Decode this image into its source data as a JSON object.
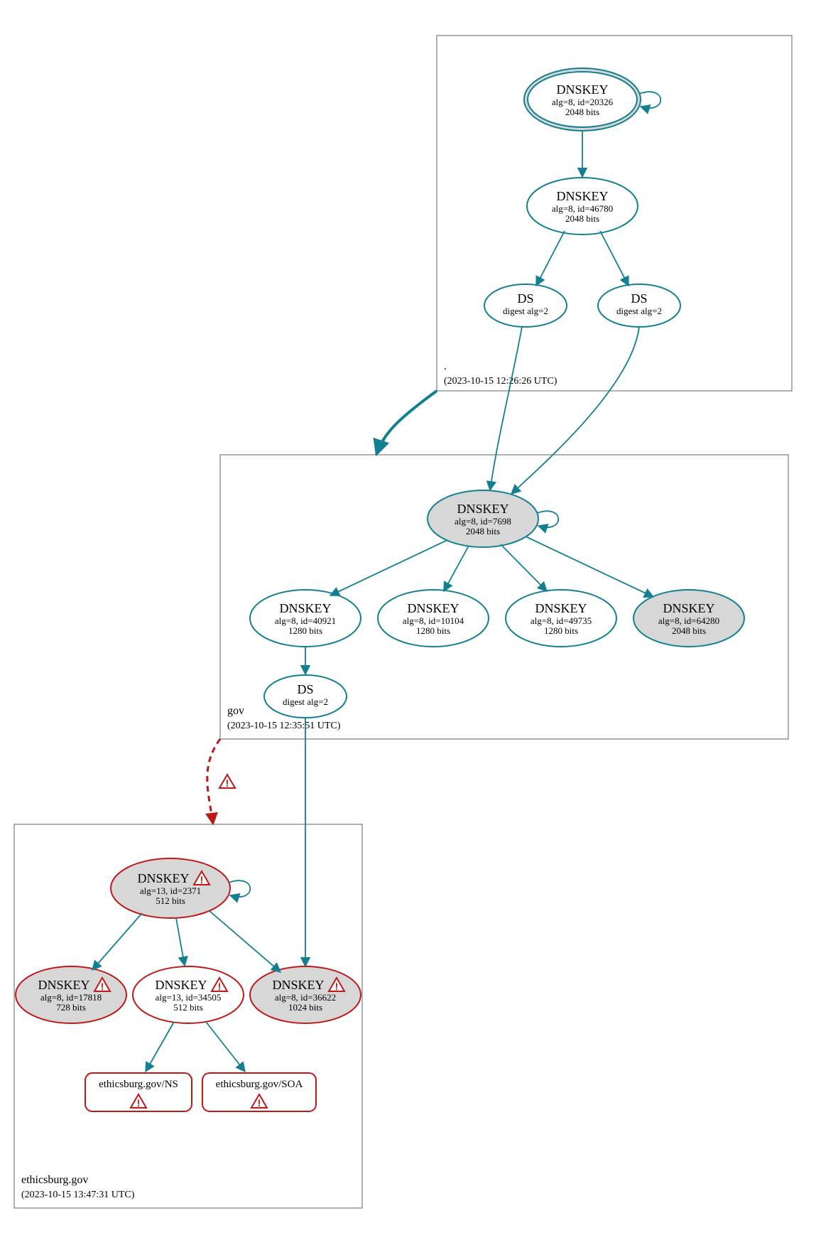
{
  "chart_data": {
    "type": "diagram",
    "description": "DNSSEC chain-of-trust graph for ethicsburg.gov",
    "zones": [
      {
        "name": ".",
        "timestamp": "(2023-10-15 12:26:26 UTC)",
        "nodes": [
          {
            "id": "root-ksk",
            "type": "DNSKEY",
            "alg": 8,
            "key_id": 20326,
            "bits": 2048,
            "sep": true,
            "trust_anchor": true,
            "warn": false
          },
          {
            "id": "root-zsk",
            "type": "DNSKEY",
            "alg": 8,
            "key_id": 46780,
            "bits": 2048,
            "sep": false,
            "warn": false
          },
          {
            "id": "root-ds1",
            "type": "DS",
            "digest_alg": 2,
            "warn": false
          },
          {
            "id": "root-ds2",
            "type": "DS",
            "digest_alg": 2,
            "warn": false
          }
        ],
        "edges": [
          {
            "from": "root-ksk",
            "to": "root-ksk",
            "self_loop": true
          },
          {
            "from": "root-ksk",
            "to": "root-zsk"
          },
          {
            "from": "root-zsk",
            "to": "root-ds1"
          },
          {
            "from": "root-zsk",
            "to": "root-ds2"
          }
        ]
      },
      {
        "name": "gov",
        "timestamp": "(2023-10-15 12:35:51 UTC)",
        "nodes": [
          {
            "id": "gov-ksk",
            "type": "DNSKEY",
            "alg": 8,
            "key_id": 7698,
            "bits": 2048,
            "sep": true,
            "warn": false
          },
          {
            "id": "gov-zsk1",
            "type": "DNSKEY",
            "alg": 8,
            "key_id": 40921,
            "bits": 1280,
            "sep": false,
            "warn": false
          },
          {
            "id": "gov-zsk2",
            "type": "DNSKEY",
            "alg": 8,
            "key_id": 10104,
            "bits": 1280,
            "sep": false,
            "warn": false
          },
          {
            "id": "gov-zsk3",
            "type": "DNSKEY",
            "alg": 8,
            "key_id": 49735,
            "bits": 1280,
            "sep": false,
            "warn": false
          },
          {
            "id": "gov-key64",
            "type": "DNSKEY",
            "alg": 8,
            "key_id": 64280,
            "bits": 2048,
            "sep": true,
            "warn": false
          },
          {
            "id": "gov-ds",
            "type": "DS",
            "digest_alg": 2,
            "warn": false
          }
        ],
        "edges": [
          {
            "from": "root-ds1",
            "to": "gov-ksk",
            "cross_zone": true
          },
          {
            "from": "root-ds2",
            "to": "gov-ksk",
            "cross_zone": true
          },
          {
            "from": "gov-ksk",
            "to": "gov-ksk",
            "self_loop": true
          },
          {
            "from": "gov-ksk",
            "to": "gov-zsk1"
          },
          {
            "from": "gov-ksk",
            "to": "gov-zsk2"
          },
          {
            "from": "gov-ksk",
            "to": "gov-zsk3"
          },
          {
            "from": "gov-ksk",
            "to": "gov-key64"
          },
          {
            "from": "gov-zsk1",
            "to": "gov-ds"
          }
        ]
      },
      {
        "name": "ethicsburg.gov",
        "timestamp": "(2023-10-15 13:47:31 UTC)",
        "nodes": [
          {
            "id": "eb-ksk",
            "type": "DNSKEY",
            "alg": 13,
            "key_id": 2371,
            "bits": 512,
            "sep": true,
            "warn": true
          },
          {
            "id": "eb-key1",
            "type": "DNSKEY",
            "alg": 8,
            "key_id": 17818,
            "bits": 728,
            "sep": true,
            "warn": true
          },
          {
            "id": "eb-zsk",
            "type": "DNSKEY",
            "alg": 13,
            "key_id": 34505,
            "bits": 512,
            "sep": false,
            "warn": true
          },
          {
            "id": "eb-key3",
            "type": "DNSKEY",
            "alg": 8,
            "key_id": 36622,
            "bits": 1024,
            "sep": true,
            "warn": true
          },
          {
            "id": "eb-ns",
            "type": "RRset",
            "label": "ethicsburg.gov/NS",
            "warn": true
          },
          {
            "id": "eb-soa",
            "type": "RRset",
            "label": "ethicsburg.gov/SOA",
            "warn": true
          }
        ],
        "edges": [
          {
            "from": "gov-ds",
            "to": "eb-key3",
            "cross_zone": true
          },
          {
            "from": "gov-zone",
            "to": "eb-zone",
            "cross_zone": true,
            "warn": true,
            "dashed": true
          },
          {
            "from": "eb-ksk",
            "to": "eb-ksk",
            "self_loop": true
          },
          {
            "from": "eb-ksk",
            "to": "eb-key1"
          },
          {
            "from": "eb-ksk",
            "to": "eb-zsk"
          },
          {
            "from": "eb-ksk",
            "to": "eb-key3"
          },
          {
            "from": "eb-zsk",
            "to": "eb-ns"
          },
          {
            "from": "eb-zsk",
            "to": "eb-soa"
          }
        ]
      }
    ]
  },
  "labels": {
    "dnskey": "DNSKEY",
    "ds": "DS",
    "root": {
      "name": ".",
      "ts": "(2023-10-15 12:26:26 UTC)",
      "ksk_sub1": "alg=8, id=20326",
      "ksk_sub2": "2048 bits",
      "zsk_sub1": "alg=8, id=46780",
      "zsk_sub2": "2048 bits",
      "ds_sub": "digest alg=2"
    },
    "gov": {
      "name": "gov",
      "ts": "(2023-10-15 12:35:51 UTC)",
      "ksk_sub1": "alg=8, id=7698",
      "ksk_sub2": "2048 bits",
      "k1_sub1": "alg=8, id=40921",
      "k1_sub2": "1280 bits",
      "k2_sub1": "alg=8, id=10104",
      "k2_sub2": "1280 bits",
      "k3_sub1": "alg=8, id=49735",
      "k3_sub2": "1280 bits",
      "k4_sub1": "alg=8, id=64280",
      "k4_sub2": "2048 bits",
      "ds_sub": "digest alg=2"
    },
    "eb": {
      "name": "ethicsburg.gov",
      "ts": "(2023-10-15 13:47:31 UTC)",
      "ksk_sub1": "alg=13, id=2371",
      "ksk_sub2": "512 bits",
      "k1_sub1": "alg=8, id=17818",
      "k1_sub2": "728 bits",
      "k2_sub1": "alg=13, id=34505",
      "k2_sub2": "512 bits",
      "k3_sub1": "alg=8, id=36622",
      "k3_sub2": "1024 bits",
      "ns": "ethicsburg.gov/NS",
      "soa": "ethicsburg.gov/SOA"
    }
  }
}
